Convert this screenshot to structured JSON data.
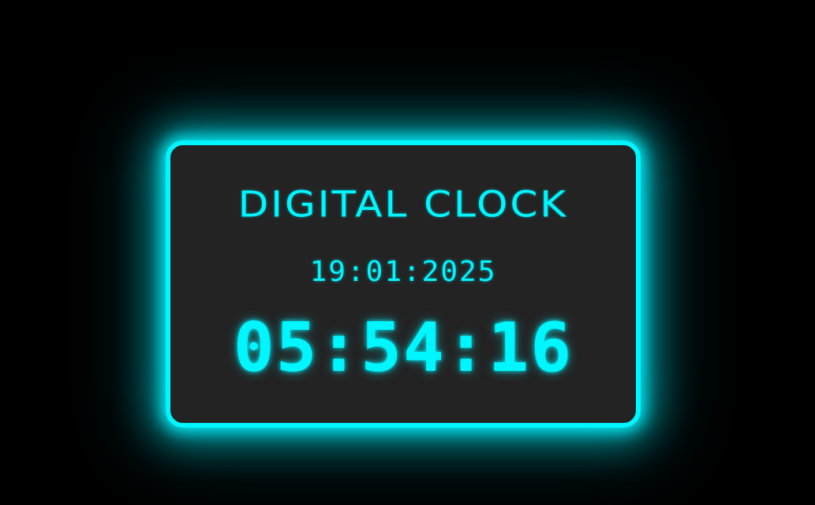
{
  "clock": {
    "title": "DIGITAL CLOCK",
    "date": "19:01:2025",
    "time": "05:54:16"
  },
  "colors": {
    "background": "#000000",
    "card_background": "#232323",
    "accent": "#00f6ff"
  }
}
